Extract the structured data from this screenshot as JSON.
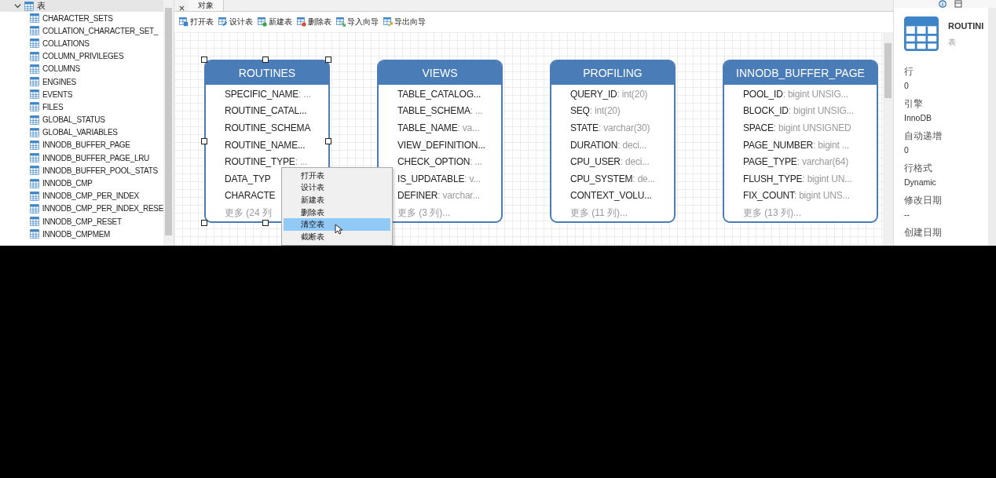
{
  "sidebar": {
    "group": {
      "label": "表",
      "expanded": true
    },
    "items": [
      {
        "label": "CHARACTER_SETS"
      },
      {
        "label": "COLLATION_CHARACTER_SET_"
      },
      {
        "label": "COLLATIONS"
      },
      {
        "label": "COLUMN_PRIVILEGES"
      },
      {
        "label": "COLUMNS"
      },
      {
        "label": "ENGINES"
      },
      {
        "label": "EVENTS"
      },
      {
        "label": "FILES"
      },
      {
        "label": "GLOBAL_STATUS"
      },
      {
        "label": "GLOBAL_VARIABLES"
      },
      {
        "label": "INNODB_BUFFER_PAGE"
      },
      {
        "label": "INNODB_BUFFER_PAGE_LRU"
      },
      {
        "label": "INNODB_BUFFER_POOL_STATS"
      },
      {
        "label": "INNODB_CMP"
      },
      {
        "label": "INNODB_CMP_PER_INDEX"
      },
      {
        "label": "INNODB_CMP_PER_INDEX_RESE"
      },
      {
        "label": "INNODB_CMP_RESET"
      },
      {
        "label": "INNODB_CMPMEM"
      }
    ]
  },
  "tabs": [
    {
      "label": "对象",
      "selected": true
    }
  ],
  "toolbar": [
    {
      "label": "打开表",
      "kind": "open"
    },
    {
      "label": "设计表",
      "kind": "design"
    },
    {
      "label": "新建表",
      "kind": "new"
    },
    {
      "label": "删除表",
      "kind": "delete"
    },
    {
      "label": "导入向导",
      "kind": "import"
    },
    {
      "label": "导出向导",
      "kind": "export"
    }
  ],
  "tables": [
    {
      "title": "ROUTINES",
      "selected": true,
      "fields": [
        {
          "name": "SPECIFIC_NAME",
          "type": ": ..."
        },
        {
          "name": "ROUTINE_CATAL..."
        },
        {
          "name": "ROUTINE_SCHEMA"
        },
        {
          "name": "ROUTINE_NAME..."
        },
        {
          "name": "ROUTINE_TYPE",
          "type": ": ..."
        },
        {
          "name": "DATA_TYP"
        },
        {
          "name": "CHARACTE"
        }
      ],
      "more": "更多 (24 列"
    },
    {
      "title": "VIEWS",
      "selected": false,
      "fields": [
        {
          "name": "TABLE_CATALOG..."
        },
        {
          "name": "TABLE_SCHEMA",
          "type": ": ..."
        },
        {
          "name": "TABLE_NAME",
          "type": ": va..."
        },
        {
          "name": "VIEW_DEFINITION..."
        },
        {
          "name": "CHECK_OPTION",
          "type": ": ..."
        },
        {
          "name": "IS_UPDATABLE",
          "type": ": v..."
        },
        {
          "name": "DEFINER",
          "type": ": varchar..."
        }
      ],
      "more": "更多 (3 列)..."
    },
    {
      "title": "PROFILING",
      "selected": false,
      "fields": [
        {
          "name": "QUERY_ID",
          "type": ": int(20)"
        },
        {
          "name": "SEQ",
          "type": ": int(20)"
        },
        {
          "name": "STATE",
          "type": ": varchar(30)"
        },
        {
          "name": "DURATION",
          "type": ": deci..."
        },
        {
          "name": "CPU_USER",
          "type": ": deci..."
        },
        {
          "name": "CPU_SYSTEM",
          "type": ": de..."
        },
        {
          "name": "CONTEXT_VOLU..."
        }
      ],
      "more": "更多 (11 列)..."
    },
    {
      "title": "INNODB_BUFFER_PAGE",
      "selected": false,
      "fields": [
        {
          "name": "POOL_ID",
          "type": ": bigint UNSIG..."
        },
        {
          "name": "BLOCK_ID",
          "type": ": bigint UNSIG..."
        },
        {
          "name": "SPACE",
          "type": ": bigint UNSIGNED"
        },
        {
          "name": "PAGE_NUMBER",
          "type": ": bigint ..."
        },
        {
          "name": "PAGE_TYPE",
          "type": ": varchar(64)"
        },
        {
          "name": "FLUSH_TYPE",
          "type": ": bigint UN..."
        },
        {
          "name": "FIX_COUNT",
          "type": ": bigint UNS..."
        }
      ],
      "more": "更多 (13 列)..."
    }
  ],
  "context_menu": {
    "items": [
      {
        "label": "打开表",
        "selected": false
      },
      {
        "label": "设计表",
        "selected": false
      },
      {
        "label": "新建表",
        "selected": false
      },
      {
        "label": "删除表",
        "selected": false
      },
      {
        "label": "清空表",
        "selected": true
      },
      {
        "label": "截断表",
        "selected": false
      }
    ]
  },
  "info_panel": {
    "title": "ROUTINI",
    "subtitle": "表",
    "properties": [
      {
        "label": "行",
        "value": "0"
      },
      {
        "label": "引擎",
        "value": "InnoDB"
      },
      {
        "label": "自动递增",
        "value": "0"
      },
      {
        "label": "行格式",
        "value": "Dynamic"
      },
      {
        "label": "修改日期",
        "value": "--"
      },
      {
        "label": "创建日期"
      }
    ]
  }
}
